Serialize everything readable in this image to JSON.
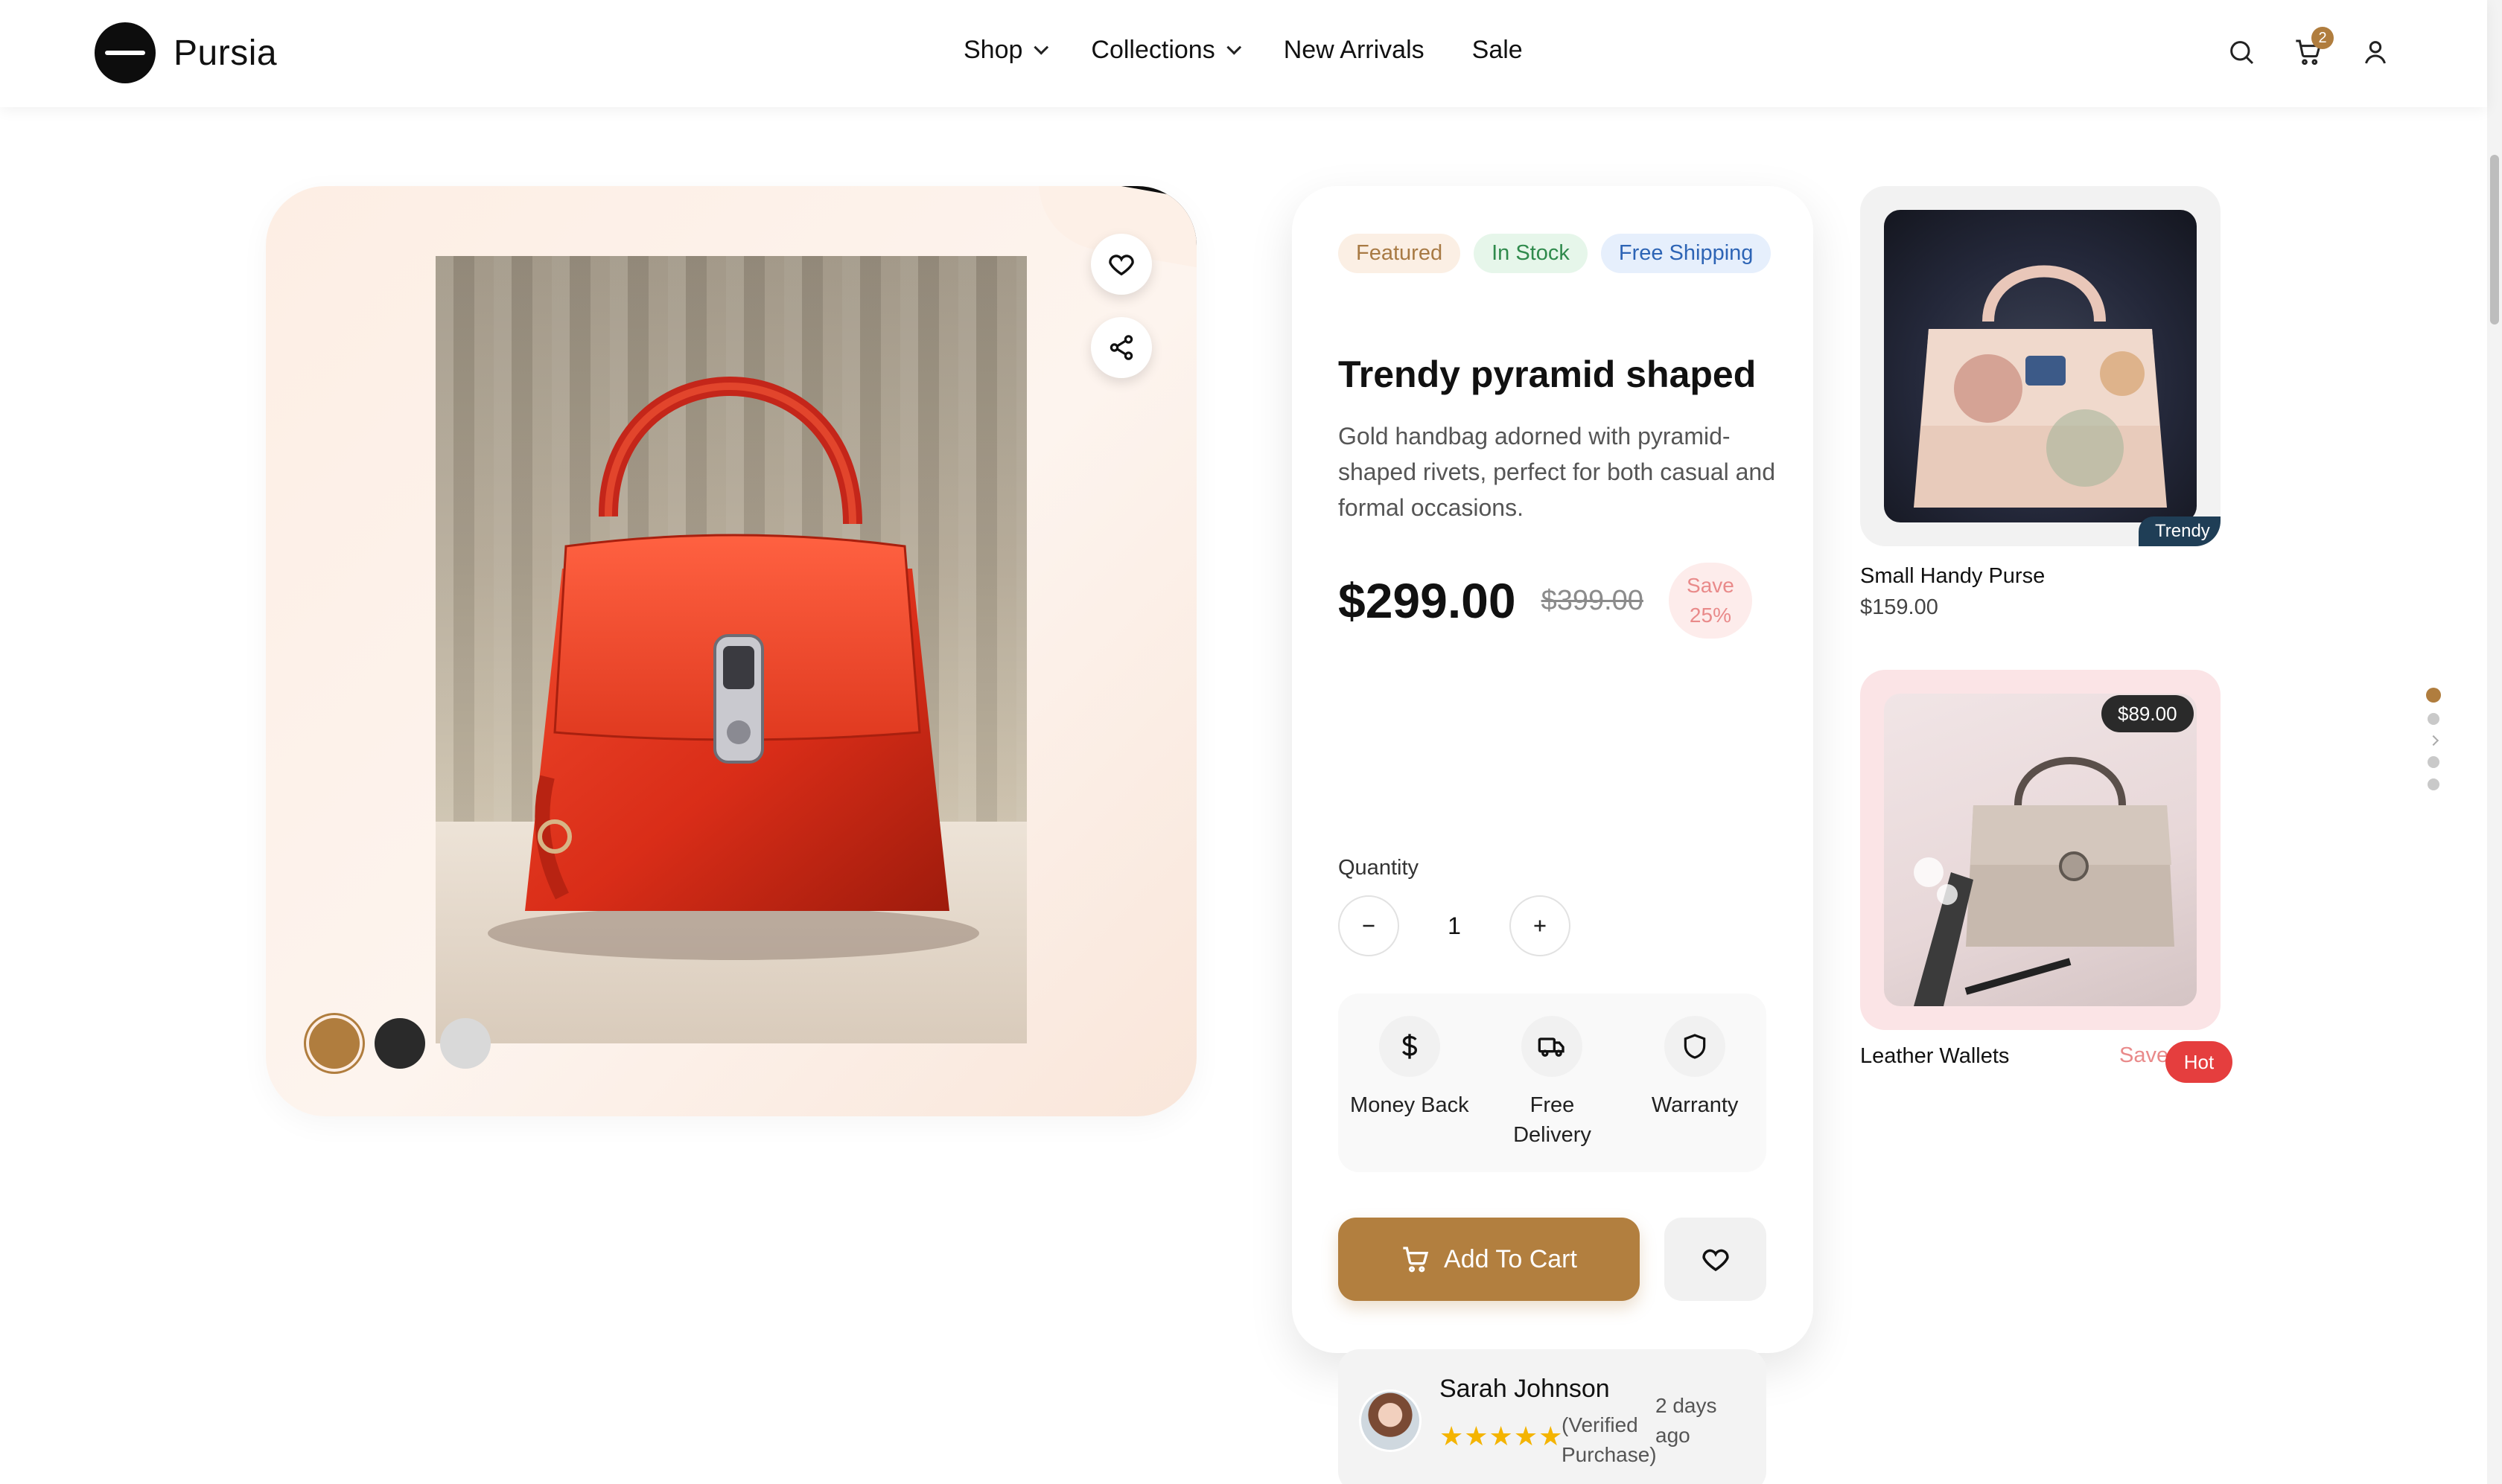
{
  "brand": {
    "name": "Pursia"
  },
  "nav": [
    {
      "label": "Shop",
      "dropdown": true
    },
    {
      "label": "Collections",
      "dropdown": true
    },
    {
      "label": "New Arrivals",
      "dropdown": false
    },
    {
      "label": "Sale",
      "dropdown": false
    }
  ],
  "header_icons": {
    "search": "search-icon",
    "cart": "cart-icon",
    "cart_count": "2",
    "account": "user-icon"
  },
  "gallery": {
    "actions": [
      "heart-icon",
      "share-icon"
    ],
    "swatches": [
      {
        "color": "#b07d3e",
        "active": true
      },
      {
        "color": "#2a2a2a",
        "active": false
      },
      {
        "color": "#d9d9d9",
        "active": false
      }
    ]
  },
  "product": {
    "tags": [
      "Featured",
      "In Stock",
      "Free Shipping"
    ],
    "title": "Trendy pyramid shaped",
    "description": "Gold handbag adorned with pyramid-shaped rivets, perfect for both casual and formal occasions.",
    "price": "$299.00",
    "old_price": "$399.00",
    "save": "Save 25%",
    "quantity_label": "Quantity",
    "quantity": "1",
    "features": [
      {
        "icon": "dollar-icon",
        "label": "Money Back"
      },
      {
        "icon": "truck-icon",
        "label": "Free Delivery"
      },
      {
        "icon": "shield-icon",
        "label": "Warranty"
      }
    ],
    "add_to_cart": "Add To Cart"
  },
  "review": {
    "name": "Sarah Johnson",
    "stars": "★★★★★",
    "verified": "(Verified Purchase)",
    "time": "2 days ago"
  },
  "related": [
    {
      "name": "Small Handy Purse",
      "price": "$159.00",
      "badge": "Trendy"
    },
    {
      "name": "Leather Wallets",
      "price_tag": "$89.00",
      "save": "Save",
      "badge": "Hot"
    }
  ],
  "colors": {
    "accent": "#b07d3e",
    "hot": "#e53e3e",
    "trendy": "#1f3e56"
  }
}
